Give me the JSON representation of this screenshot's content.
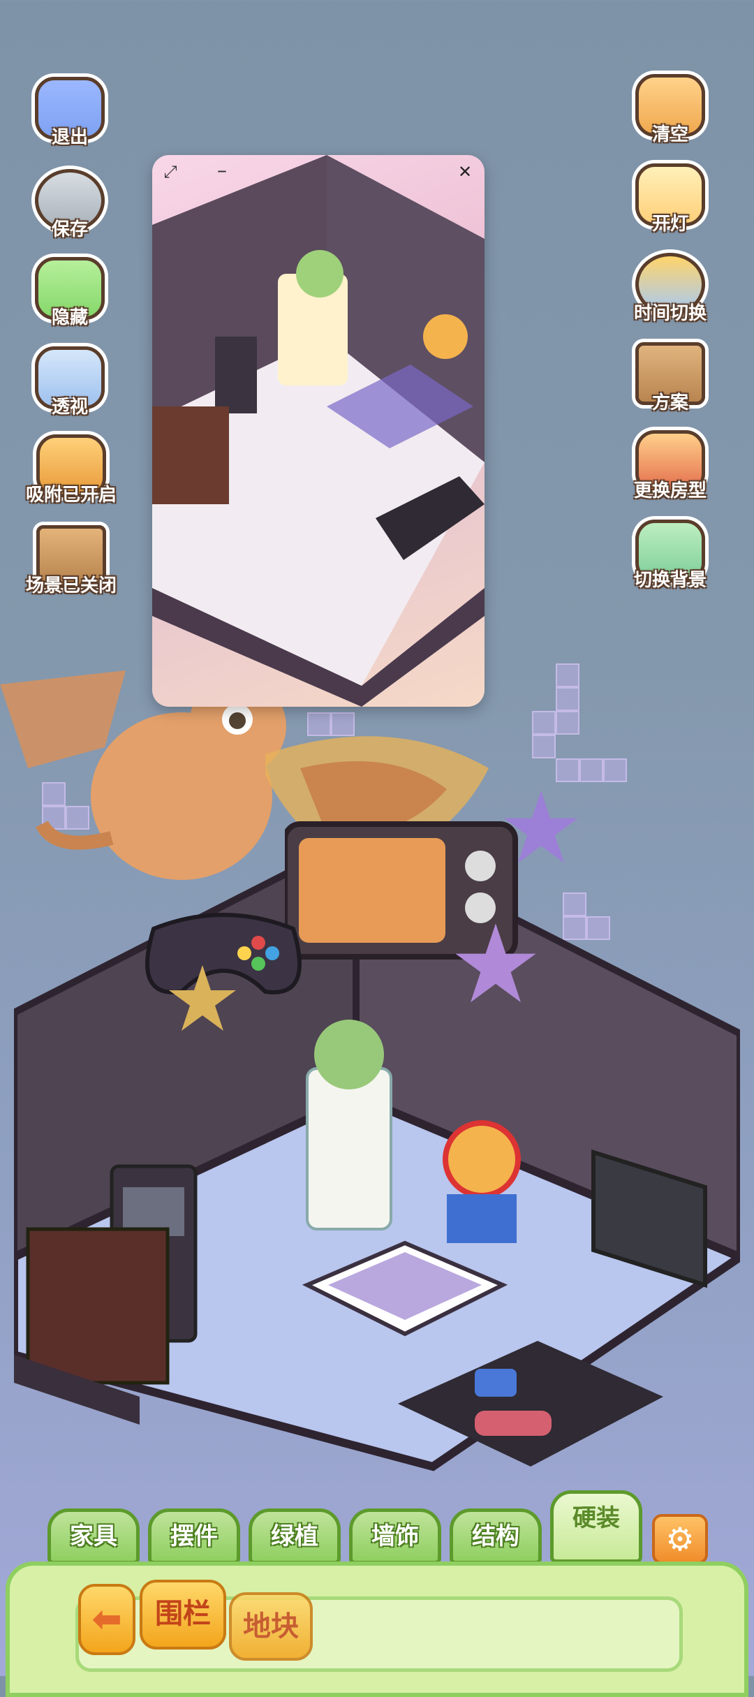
{
  "left_menu": [
    {
      "label": "退出",
      "icon": "exit-arrow-icon"
    },
    {
      "label": "保存",
      "icon": "save-icon"
    },
    {
      "label": "隐藏",
      "icon": "hide-icon"
    },
    {
      "label": "透视",
      "icon": "perspective-cube-icon"
    },
    {
      "label": "吸附已开启",
      "icon": "snap-icon"
    },
    {
      "label": "场景已关闭",
      "icon": "scene-icon"
    }
  ],
  "right_menu": [
    {
      "label": "清空",
      "icon": "clear-icon"
    },
    {
      "label": "开灯",
      "icon": "light-icon"
    },
    {
      "label": "时间切换",
      "icon": "time-switch-icon"
    },
    {
      "label": "方案",
      "icon": "plan-icon"
    },
    {
      "label": "更换房型",
      "icon": "room-type-icon"
    },
    {
      "label": "切换背景",
      "icon": "background-switch-icon"
    }
  ],
  "tabs": [
    "家具",
    "摆件",
    "绿植",
    "墙饰",
    "结构",
    "硬装"
  ],
  "active_tab": "硬装",
  "sub_buttons": [
    "围栏",
    "地块"
  ],
  "colors": {
    "accent_green": "#8fcf60",
    "accent_orange": "#f3a51c",
    "bg": "#8498ad"
  }
}
